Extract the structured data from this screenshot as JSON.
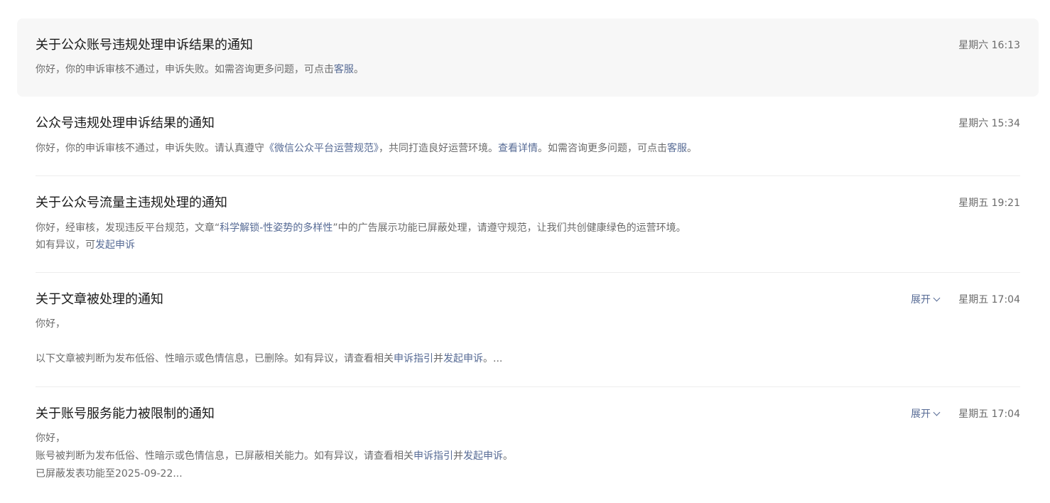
{
  "notifications": [
    {
      "title": "关于公众账号违规处理申诉结果的通知",
      "time": "星期六 16:13",
      "line1": {
        "pre": "你好，你的申诉审核不通过，申诉失败。如需咨询更多问题，可点击",
        "link": "客服",
        "post": "。"
      }
    },
    {
      "title": "公众号违规处理申诉结果的通知",
      "time": "星期六 15:34",
      "line1": {
        "pre": "你好，你的申诉审核不通过，申诉失败。请认真遵守",
        "link1": "《微信公众平台运营规范》",
        "mid": "，共同打造良好运营环境。",
        "link2": "查看详情",
        "mid2": "。如需咨询更多问题，可点击",
        "link3": "客服",
        "post": "。"
      }
    },
    {
      "title": "关于公众号流量主违规处理的通知",
      "time": "星期五 19:21",
      "line1": {
        "pre": "你好，经审核，发现违反平台规范，文章“",
        "link": "科学解锁-性姿势的多样性",
        "post": "”中的广告展示功能已屏蔽处理，请遵守规范，让我们共创健康绿色的运营环境。"
      },
      "line2": {
        "pre": "如有异议，可",
        "link": "发起申诉"
      }
    },
    {
      "title": "关于文章被处理的通知",
      "time": "星期五 17:04",
      "expand": "展开",
      "line1": "你好，",
      "line3": {
        "pre": "以下文章被判断为发布低俗、性暗示或色情信息，已删除。如有异议，请查看相关",
        "link1": "申诉指引",
        "mid": "并",
        "link2": "发起申诉",
        "post": "。..."
      }
    },
    {
      "title": "关于账号服务能力被限制的通知",
      "time": "星期五 17:04",
      "expand": "展开",
      "line1": "你好，",
      "line2": {
        "pre": "账号被判断为发布低俗、性暗示或色情信息，已屏蔽相关能力。如有异议，请查看相关",
        "link1": "申诉指引",
        "mid": "并",
        "link2": "发起申诉",
        "post": "。"
      },
      "line3": "已屏蔽发表功能至2025-09-22..."
    }
  ],
  "colors": {
    "link": "#576b95",
    "text_secondary": "#6b6b6b",
    "title": "#1a1a1a",
    "highlight_bg": "#f7f7f7"
  }
}
